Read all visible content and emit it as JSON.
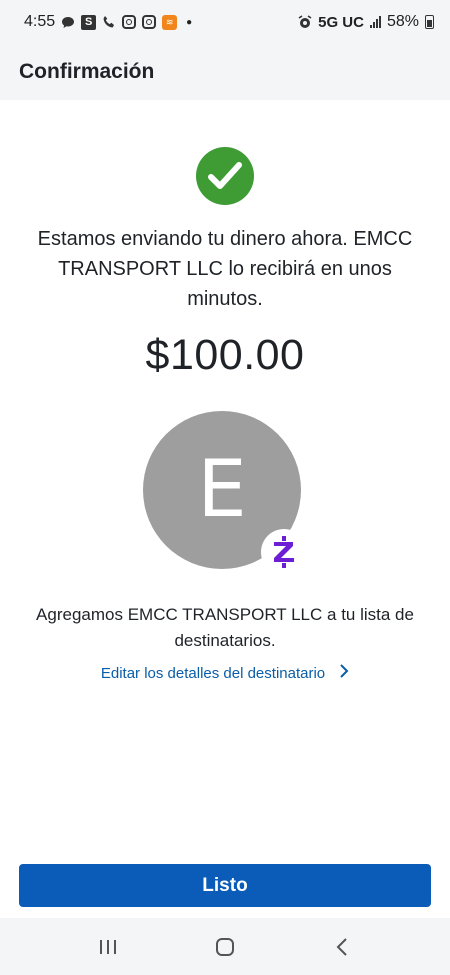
{
  "status_bar": {
    "time": "4:55",
    "network": "5G UC",
    "battery": "58%",
    "icons": [
      "chat-icon",
      "s-app-icon",
      "phone-icon",
      "instagram-icon",
      "instagram-icon",
      "orange-app-icon",
      "dot-icon",
      "alarm-icon",
      "signal-icon",
      "battery-icon"
    ]
  },
  "header": {
    "title": "Confirmación"
  },
  "confirmation": {
    "message": "Estamos enviando tu dinero ahora. EMCC TRANSPORT LLC lo recibirá en unos minutos.",
    "amount": "$100.00",
    "avatar_initial": "E",
    "added_message": "Agregamos EMCC TRANSPORT LLC a tu lista de destinatarios.",
    "edit_link_label": "Editar los detalles del destinatario"
  },
  "actions": {
    "done_label": "Listo"
  },
  "colors": {
    "success": "#3f9c35",
    "primary": "#0a5cb8",
    "link": "#0a5ea8",
    "zelle": "#6d1ed4",
    "avatar": "#9e9e9e"
  }
}
